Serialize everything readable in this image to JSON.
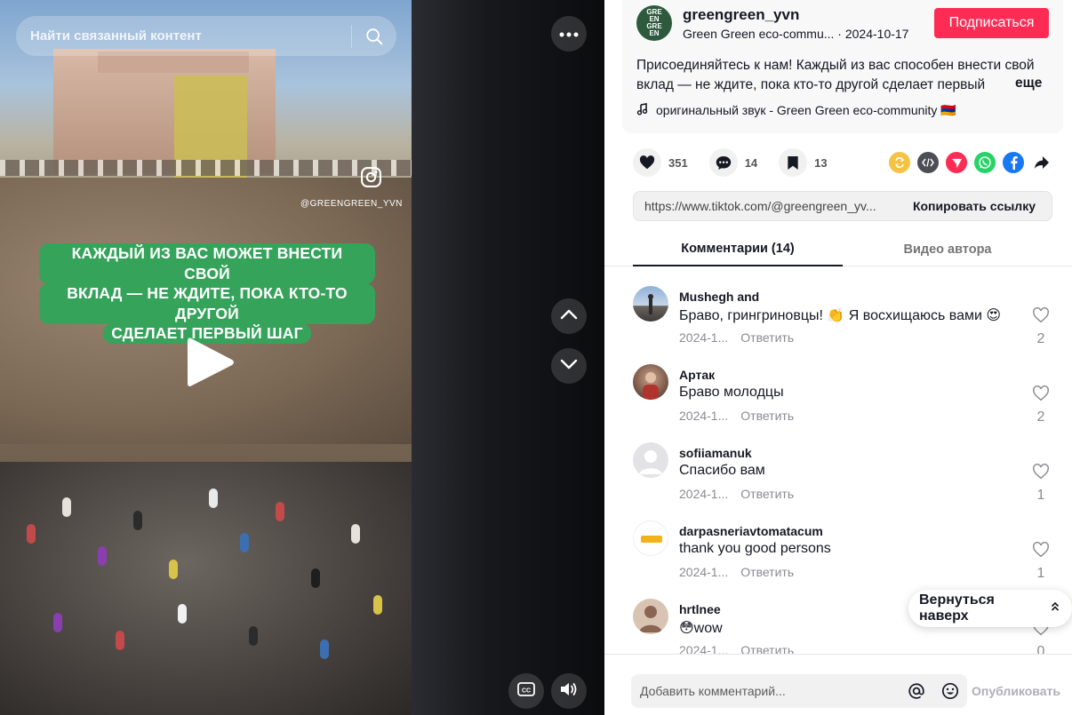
{
  "search": {
    "placeholder": "Найти связанный контент"
  },
  "video": {
    "watermark_handle": "@GREENGREEN_YVN",
    "caption_lines": [
      "КАЖДЫЙ ИЗ ВАС МОЖЕТ ВНЕСТИ СВОЙ",
      "ВКЛАД — НЕ ЖДИТЕ, ПОКА КТО-ТО ДРУГОЙ",
      "СДЕЛАЕТ ПЕРВЫЙ ШАГ"
    ]
  },
  "author": {
    "avatar_text": [
      "GRE",
      "EN",
      "GRE",
      "EN"
    ],
    "username": "greengreen_yvn",
    "display_name": "Green  Green  eco-commu...",
    "date": "· 2024-10-17",
    "follow_label": "Подписаться"
  },
  "post": {
    "description": "Присоединяйтесь к нам! Каждый из вас способен внести свой вклад — не ждите, пока кто-то другой сделает первый",
    "more_label": "еще",
    "sound": "оригинальный звук - Green  Green  eco-community  🇦🇲"
  },
  "stats": {
    "likes": "351",
    "comments": "14",
    "saves": "13"
  },
  "link": {
    "url": "https://www.tiktok.com/@greengreen_yv...",
    "copy_label": "Копировать ссылку"
  },
  "tabs": [
    {
      "label": "Комментарии (14)"
    },
    {
      "label": "Видео автора"
    }
  ],
  "comments": [
    {
      "name": "Mushegh and",
      "text": "Браво, грингриновцы! 👏 Я восхищаюсь вами 😍",
      "date": "2024-1...",
      "reply": "Ответить",
      "likes": "2"
    },
    {
      "name": "Артак",
      "text": "Браво молодцы",
      "date": "2024-1...",
      "reply": "Ответить",
      "likes": "2"
    },
    {
      "name": "sofiiamanuk",
      "text": "Спасибо вам",
      "date": "2024-1...",
      "reply": "Ответить",
      "likes": "1"
    },
    {
      "name": "darpasneriavtomatacum",
      "text": "thank you good persons",
      "date": "2024-1...",
      "reply": "Ответить",
      "likes": "1"
    },
    {
      "name": "hrtlnee",
      "text": "😳wow",
      "date": "2024-1...",
      "reply": "Ответить",
      "likes": "0"
    }
  ],
  "back_to_top": "Вернуться наверх",
  "composer": {
    "placeholder": "Добавить комментарий...",
    "post_label": "Опубликовать"
  },
  "colors": {
    "accent": "#fe2c55",
    "caption_green": "#35a35a"
  }
}
